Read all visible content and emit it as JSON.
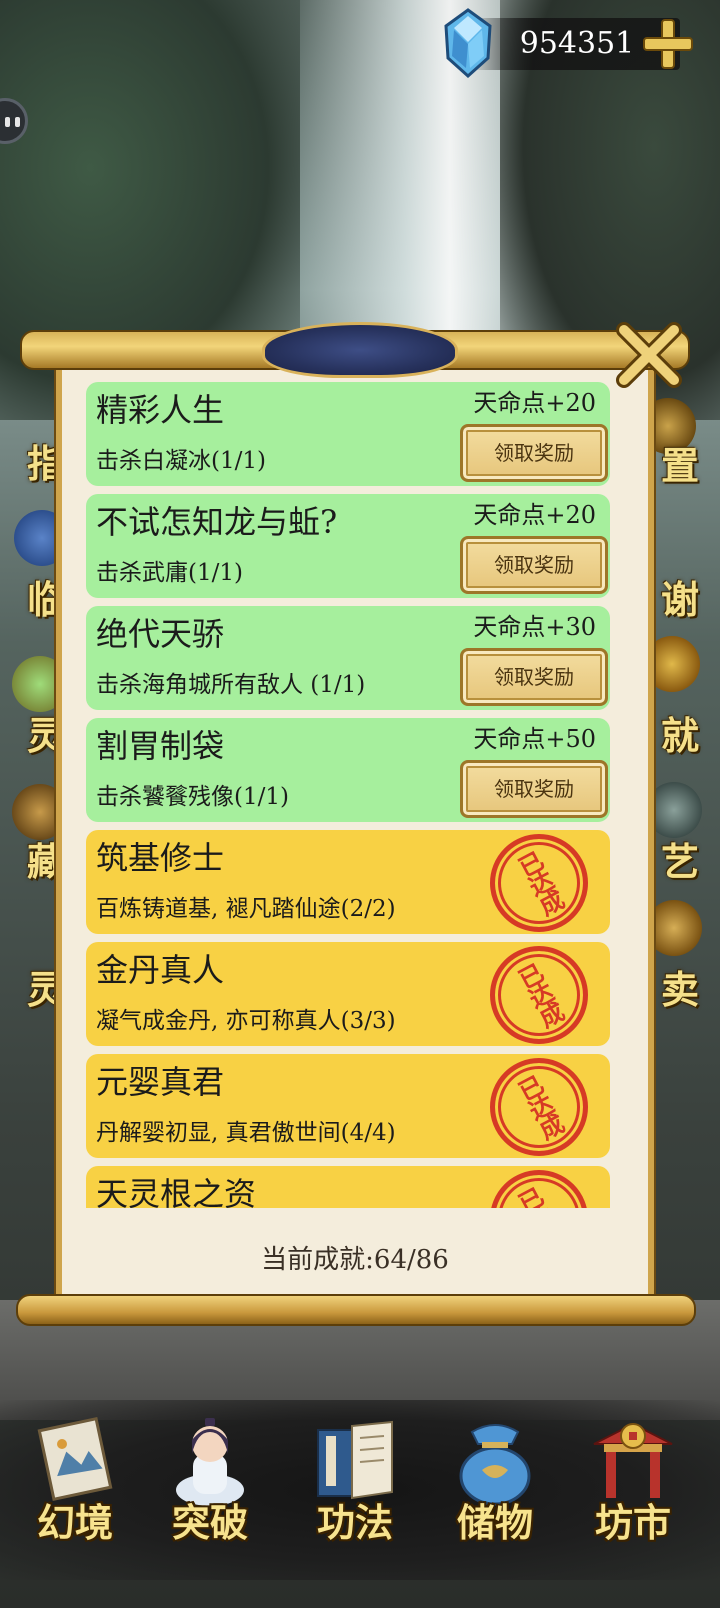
{
  "header": {
    "currency_amount": "954351",
    "currency_icon": "gem-icon",
    "add_icon": "plus-icon"
  },
  "side_menu_left": [
    "指",
    "临",
    "灵",
    "藏",
    "灵"
  ],
  "side_menu_right": [
    "置",
    "谢",
    "就",
    "艺",
    "卖"
  ],
  "achievements": [
    {
      "title": "精彩人生",
      "desc": "击杀白凝冰(1/1)",
      "reward": "天命点+20",
      "status": "claimable",
      "button": "领取奖励"
    },
    {
      "title": "不试怎知龙与蚯?",
      "desc": "击杀武庸(1/1)",
      "reward": "天命点+20",
      "status": "claimable",
      "button": "领取奖励"
    },
    {
      "title": "绝代天骄",
      "desc": "击杀海角城所有敌人 (1/1)",
      "reward": "天命点+30",
      "status": "claimable",
      "button": "领取奖励"
    },
    {
      "title": "割胃制袋",
      "desc": "击杀饕餮残像(1/1)",
      "reward": "天命点+50",
      "status": "claimable",
      "button": "领取奖励"
    },
    {
      "title": "筑基修士",
      "desc": "百炼铸道基, 褪凡踏仙途(2/2)",
      "status": "completed",
      "stamp": "已达成"
    },
    {
      "title": "金丹真人",
      "desc": "凝气成金丹, 亦可称真人(3/3)",
      "status": "completed",
      "stamp": "已达成"
    },
    {
      "title": "元婴真君",
      "desc": "丹解婴初显, 真君傲世间(4/4)",
      "status": "completed",
      "stamp": "已达成"
    },
    {
      "title": "天灵根之资",
      "desc": "",
      "status": "completed",
      "stamp": "已达成"
    }
  ],
  "progress": {
    "label": "当前成就:64/86"
  },
  "bottom_nav": [
    {
      "label": "幻境",
      "icon": "scroll-painting-icon"
    },
    {
      "label": "突破",
      "icon": "cultivator-icon"
    },
    {
      "label": "功法",
      "icon": "book-icon"
    },
    {
      "label": "储物",
      "icon": "storage-bag-icon"
    },
    {
      "label": "坊市",
      "icon": "market-gate-icon"
    }
  ],
  "colors": {
    "claimable_card": "#a6ef9d",
    "completed_card": "#f8d144",
    "stamp": "#d63a25",
    "nav_label": "#f7e38e"
  }
}
